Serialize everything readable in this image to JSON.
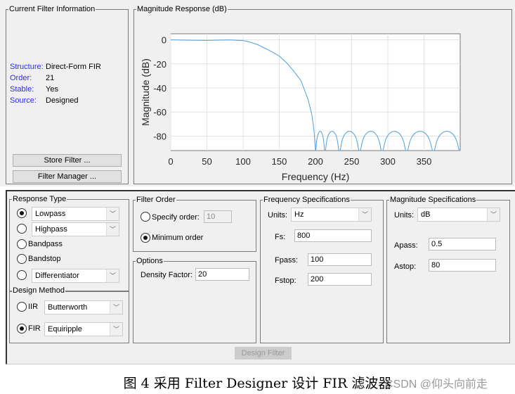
{
  "filter_info": {
    "title": "Current Filter Information",
    "rows": [
      {
        "label": "Structure:",
        "value": "Direct-Form FIR"
      },
      {
        "label": "Order:",
        "value": "21"
      },
      {
        "label": "Stable:",
        "value": "Yes"
      },
      {
        "label": "Source:",
        "value": "Designed"
      }
    ],
    "store_filter": "Store Filter ...",
    "filter_manager": "Filter Manager ..."
  },
  "magnitude_panel": {
    "title": "Magnitude Response (dB)"
  },
  "chart_data": {
    "type": "line",
    "xlabel": "Frequency (Hz)",
    "ylabel": "Magnitude (dB)",
    "xlim": [
      0,
      400
    ],
    "ylim": [
      -92,
      5
    ],
    "xticks": [
      "0",
      "50",
      "100",
      "150",
      "200",
      "250",
      "300",
      "350"
    ],
    "yticks": [
      "0",
      "-20",
      "-40",
      "-60",
      "-80"
    ],
    "grid": true,
    "color": "#4f9fd8",
    "passband": {
      "x": [
        0,
        25,
        50,
        80,
        100,
        110,
        120,
        130,
        140,
        150,
        160,
        170,
        180,
        190,
        195,
        198,
        200
      ],
      "y": [
        0,
        -0.3,
        -0.5,
        -0.1,
        -0.6,
        -2,
        -4,
        -7,
        -10,
        -13.5,
        -19,
        -26,
        -34,
        -50,
        -62,
        -75,
        -92
      ]
    },
    "stopband_nulls": [
      200,
      213,
      233,
      261,
      292,
      326,
      363,
      400
    ],
    "stopband_peak_db": -76
  },
  "response_type": {
    "title": "Response Type",
    "lowpass": "Lowpass",
    "highpass": "Highpass",
    "bandpass": "Bandpass",
    "bandstop": "Bandstop",
    "differentiator": "Differentiator",
    "selected": "Lowpass"
  },
  "design_method": {
    "title": "Design Method",
    "iir": "IIR",
    "iir_value": "Butterworth",
    "fir": "FIR",
    "fir_value": "Equiripple",
    "selected": "FIR"
  },
  "filter_order": {
    "title": "Filter Order",
    "specify": "Specify order:",
    "specify_value": "10",
    "minimum": "Minimum order",
    "selected": "Minimum order"
  },
  "options": {
    "title": "Options",
    "density_label": "Density Factor:",
    "density_value": "20"
  },
  "freq_spec": {
    "title": "Frequency Specifications",
    "units_label": "Units:",
    "units": "Hz",
    "fs_label": "Fs:",
    "fs": "800",
    "fpass_label": "Fpass:",
    "fpass": "100",
    "fstop_label": "Fstop:",
    "fstop": "200"
  },
  "mag_spec": {
    "title": "Magnitude Specifications",
    "units_label": "Units:",
    "units": "dB",
    "apass_label": "Apass:",
    "apass": "0.5",
    "astop_label": "Astop:",
    "astop": "80"
  },
  "design_filter": "Design Filter",
  "caption": "图 4 采用 Filter Designer 设计 FIR 滤波器",
  "watermark": "CSDN @仰头向前走"
}
